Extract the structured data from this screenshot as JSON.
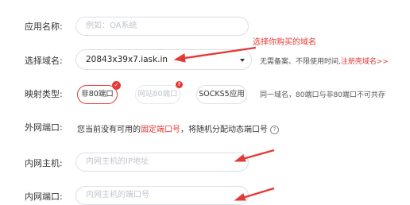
{
  "form": {
    "app_name": {
      "label": "应用名称:",
      "placeholder": "例如：OA系统"
    },
    "domain": {
      "label": "选择域名:",
      "value": "20843x39x7.iask.in",
      "note_prefix": "无需备案、不限使用时间,",
      "note_link": "注册壳域名>>",
      "annotation": "选择你购买的域名"
    },
    "mapping_type": {
      "label": "映射类型:",
      "options": [
        "非80端口",
        "网站80端口",
        "SOCKS5应用"
      ],
      "selected": "非80端口",
      "note": "同一域名，80端口与非80端口不可共存"
    },
    "external_port": {
      "label": "外网端口:",
      "text_prefix": "您当前没有可用的",
      "text_link": "固定端口号",
      "text_suffix": "，将随机分配动态端口号",
      "help_glyph": "?"
    },
    "internal_host": {
      "label": "内网主机:",
      "placeholder": "内网主机的IP地址"
    },
    "internal_port": {
      "label": "内网端口:",
      "placeholder": "内网主机的端口号"
    }
  },
  "colors": {
    "accent": "#e53935",
    "border": "#dcdfe6",
    "placeholder": "#c0c4cc"
  },
  "icons": {
    "selected_badge": "check-icon",
    "notice_badge": "question-icon",
    "dropdown": "caret-down-icon",
    "help": "help-circle-icon"
  }
}
